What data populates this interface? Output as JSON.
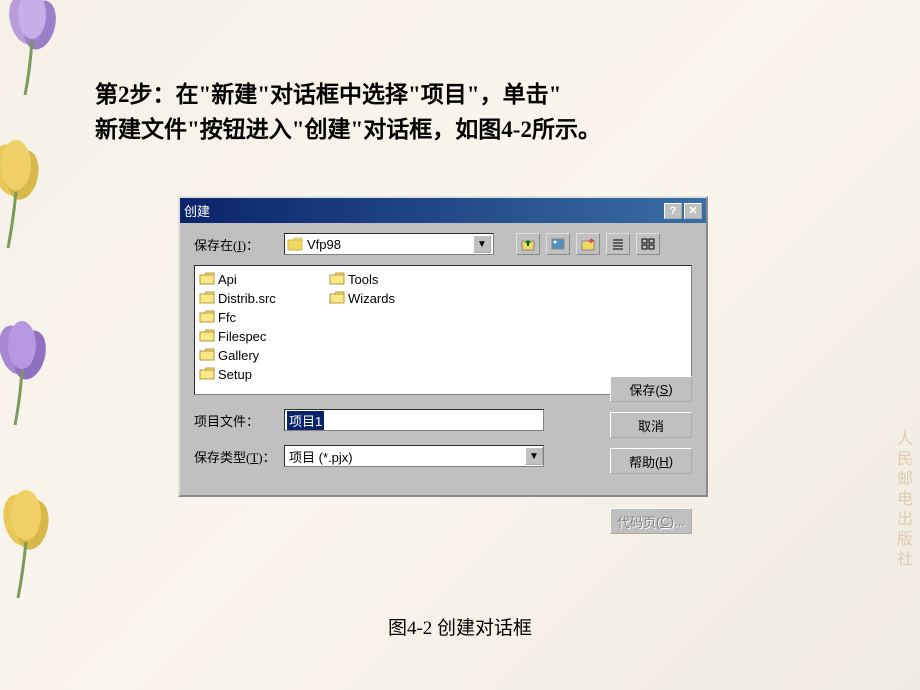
{
  "instruction": {
    "line1": "第2步：在\"新建\"对话框中选择\"项目\"，单击\"",
    "line2": "新建文件\"按钮进入\"创建\"对话框，如图4-2所示。"
  },
  "dialog": {
    "title": "创建",
    "saveInLabel": "保存在(I)：",
    "saveInValue": "Vfp98",
    "folders": {
      "col1": [
        "Api",
        "Distrib.src",
        "Ffc",
        "Filespec",
        "Gallery",
        "Setup"
      ],
      "col2": [
        "Tools",
        "Wizards"
      ]
    },
    "filenameLabel": "项目文件：",
    "filenameValue": "项目1",
    "typeLabel": "保存类型(T)：",
    "typeValue": "项目 (*.pjx)",
    "buttons": {
      "save": "保存(S)",
      "cancel": "取消",
      "help": "帮助(H)",
      "codepage": "代码页(C)..."
    }
  },
  "caption": "图4-2  创建对话框",
  "watermark": "人民邮电出版社"
}
